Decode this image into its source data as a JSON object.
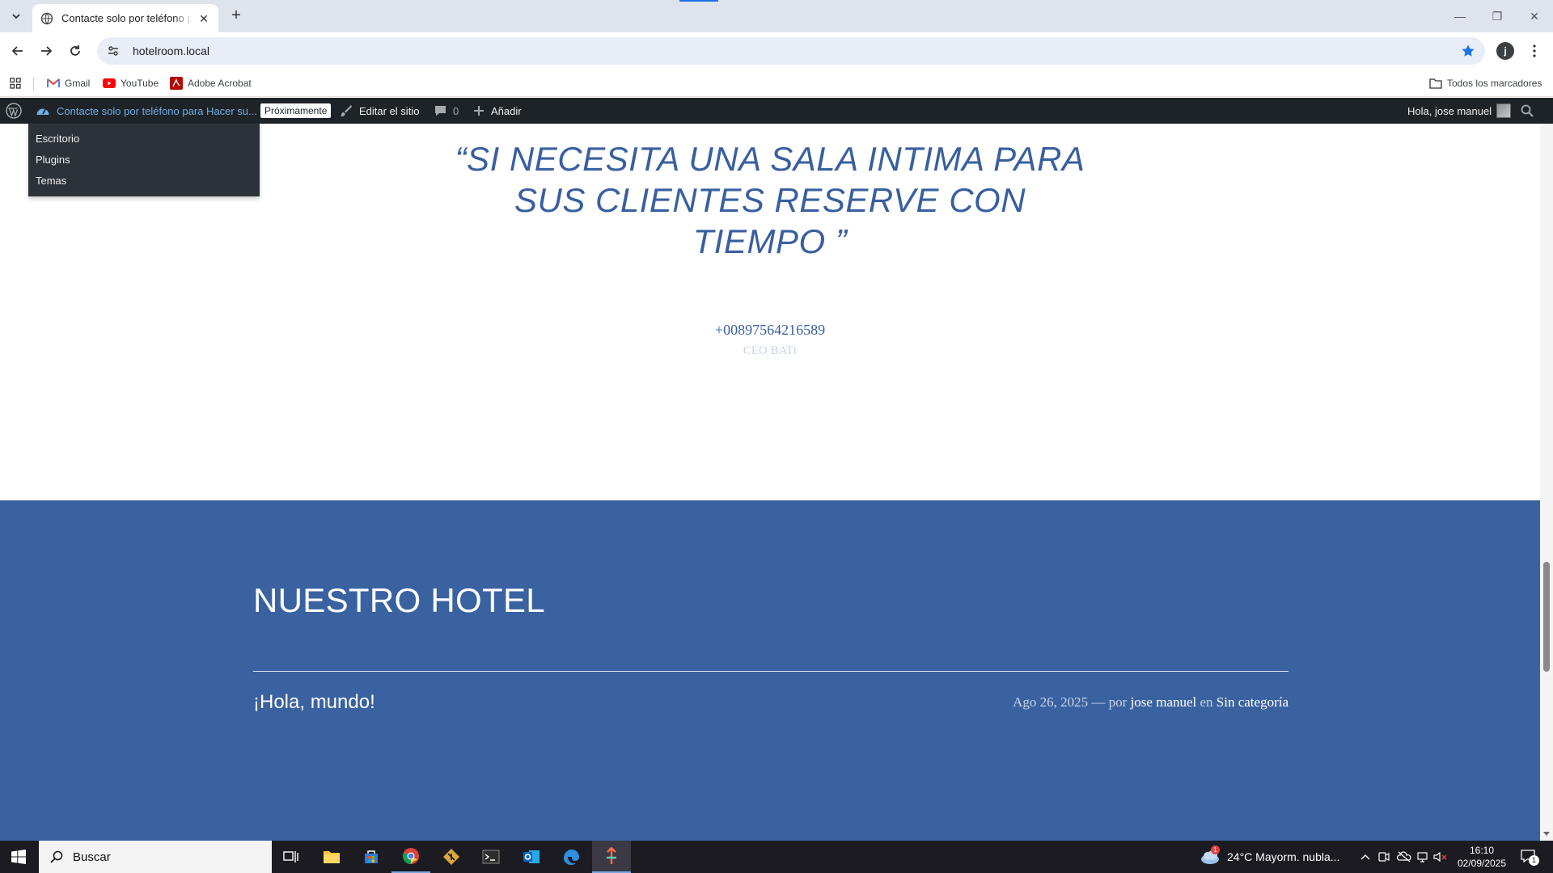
{
  "browser": {
    "tab_title": "Contacte solo por teléfono para Hacer su reserva",
    "url": "hotelroom.local",
    "profile_initial": "j",
    "bookmarks": [
      {
        "label": "Gmail",
        "icon": "gmail-icon"
      },
      {
        "label": "YouTube",
        "icon": "youtube-icon"
      },
      {
        "label": "Adobe Acrobat",
        "icon": "acrobat-icon"
      }
    ],
    "all_bookmarks_label": "Todos los marcadores"
  },
  "adminbar": {
    "site_name": "Contacte solo por teléfono para Hacer su...",
    "coming_soon": "Próximamente",
    "edit_site": "Editar el sitio",
    "comments_count": "0",
    "add_new": "Añadir",
    "greeting": "Hola, jose manuel",
    "dropdown_items": [
      "Escritorio",
      "Plugins",
      "Temas"
    ]
  },
  "content": {
    "quote": "“SI NECESITA UNA SALA INTIMA PARA SUS CLIENTES RESERVE CON TIEMPO ”",
    "phone": "+00897564216589",
    "citation": "CEO BATt",
    "section_title": "NUESTRO HOTEL",
    "post": {
      "title": "¡Hola, mundo!",
      "date": "Ago 26, 2025",
      "dash": "—",
      "by": "por",
      "author": "jose manuel",
      "in": "en",
      "category": "Sin categoría"
    }
  },
  "taskbar": {
    "search_placeholder": "Buscar",
    "weather": "24°C  Mayorm. nubla...",
    "weather_alert": "1",
    "time": "16:10",
    "date": "02/09/2025",
    "notification_count": "1"
  },
  "colors": {
    "accent": "#395f9f",
    "section_bg": "#3a62a0",
    "adminbar_bg": "#1d2327"
  }
}
